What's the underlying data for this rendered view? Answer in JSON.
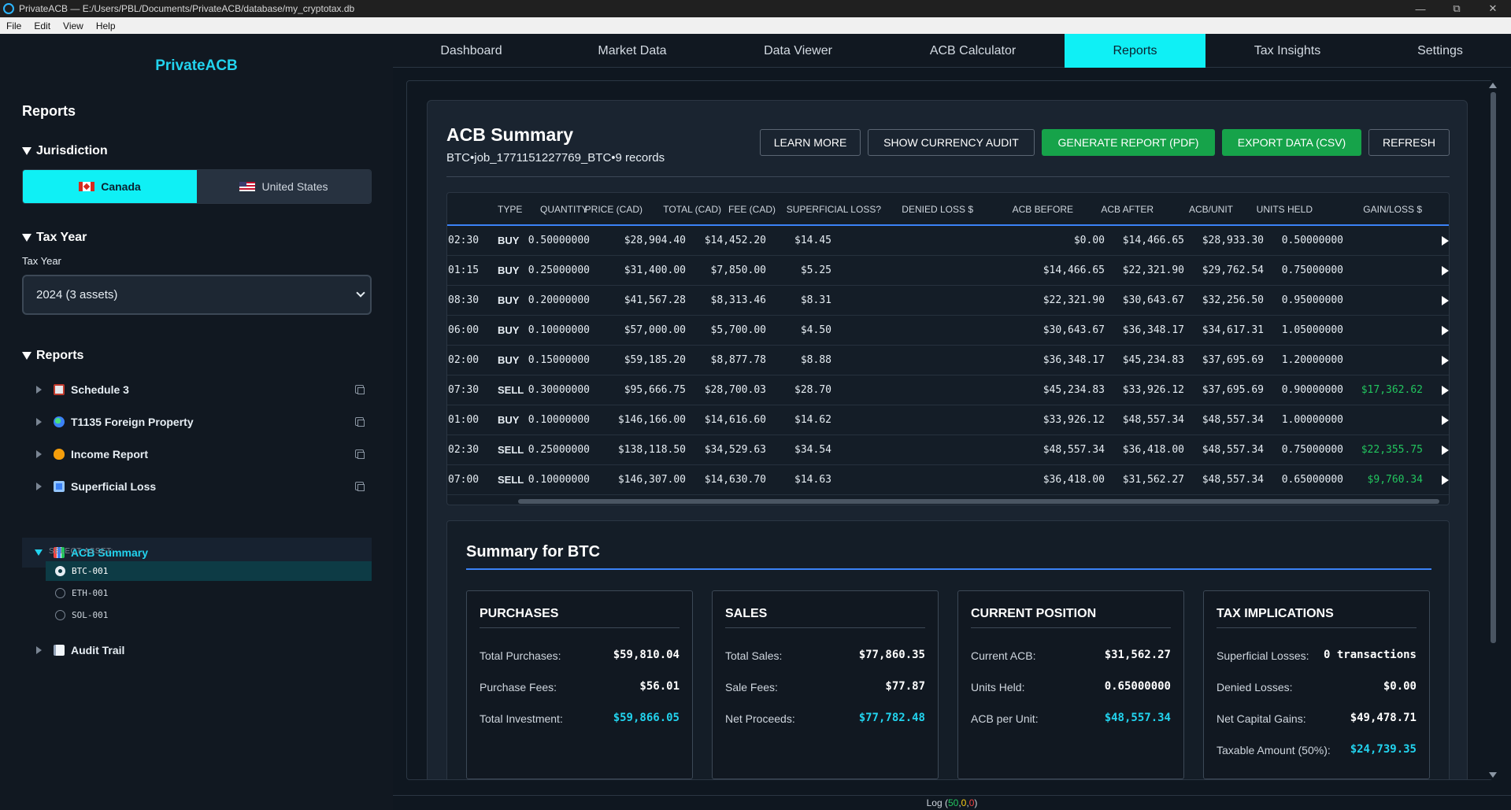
{
  "window": {
    "title": "PrivateACB — E:/Users/PBL/Documents/PrivateACB/database/my_cryptotax.db",
    "menu": [
      "File",
      "Edit",
      "View",
      "Help"
    ]
  },
  "sidebar": {
    "brand": "PrivateACB",
    "heading": "Reports",
    "jurisdiction": {
      "title": "Jurisdiction",
      "options": [
        "Canada",
        "United States"
      ],
      "selected": "Canada"
    },
    "tax_year": {
      "title": "Tax Year",
      "label": "Tax Year",
      "selected": "2024 (3 assets)"
    },
    "reports": {
      "title": "Reports",
      "items": [
        {
          "label": "Schedule 3",
          "icon": "calculator-icon"
        },
        {
          "label": "T1135 Foreign Property",
          "icon": "globe-icon"
        },
        {
          "label": "Income Report",
          "icon": "money-bag-icon"
        },
        {
          "label": "Superficial Loss",
          "icon": "cycle-icon"
        },
        {
          "label": "ACB Summary",
          "icon": "bar-chart-icon"
        },
        {
          "label": "Audit Trail",
          "icon": "document-icon"
        }
      ],
      "select_asset_label": "SELECT ASSET:",
      "assets": [
        "BTC-001",
        "ETH-001",
        "SOL-001"
      ],
      "selected_asset": "BTC-001"
    }
  },
  "tabs": [
    "Dashboard",
    "Market Data",
    "Data Viewer",
    "ACB Calculator",
    "Reports",
    "Tax Insights",
    "Settings"
  ],
  "active_tab": "Reports",
  "report": {
    "title": "ACB Summary",
    "subtitle": "BTC•job_1771151227769_BTC•9 records",
    "buttons": {
      "learn_more": "LEARN MORE",
      "currency_audit": "SHOW CURRENCY AUDIT",
      "generate_pdf": "GENERATE REPORT (PDF)",
      "export_csv": "EXPORT DATA (CSV)",
      "refresh": "REFRESH"
    },
    "columns": [
      "TYPE",
      "QUANTITY",
      "PRICE (CAD)",
      "TOTAL (CAD)",
      "FEE (CAD)",
      "SUPERFICIAL LOSS?",
      "DENIED LOSS $",
      "ACB BEFORE",
      "ACB AFTER",
      "ACB/UNIT",
      "UNITS HELD",
      "GAIN/LOSS $"
    ],
    "rows": [
      {
        "time": "02:30",
        "type": "BUY",
        "qty": "0.50000000",
        "price": "$28,904.40",
        "total": "$14,452.20",
        "fee": "$14.45",
        "sup": "",
        "denied": "",
        "before": "$0.00",
        "after": "$14,466.65",
        "unit": "$28,933.30",
        "held": "0.50000000",
        "gain": ""
      },
      {
        "time": "01:15",
        "type": "BUY",
        "qty": "0.25000000",
        "price": "$31,400.00",
        "total": "$7,850.00",
        "fee": "$5.25",
        "sup": "",
        "denied": "",
        "before": "$14,466.65",
        "after": "$22,321.90",
        "unit": "$29,762.54",
        "held": "0.75000000",
        "gain": ""
      },
      {
        "time": "08:30",
        "type": "BUY",
        "qty": "0.20000000",
        "price": "$41,567.28",
        "total": "$8,313.46",
        "fee": "$8.31",
        "sup": "",
        "denied": "",
        "before": "$22,321.90",
        "after": "$30,643.67",
        "unit": "$32,256.50",
        "held": "0.95000000",
        "gain": ""
      },
      {
        "time": "06:00",
        "type": "BUY",
        "qty": "0.10000000",
        "price": "$57,000.00",
        "total": "$5,700.00",
        "fee": "$4.50",
        "sup": "",
        "denied": "",
        "before": "$30,643.67",
        "after": "$36,348.17",
        "unit": "$34,617.31",
        "held": "1.05000000",
        "gain": ""
      },
      {
        "time": "02:00",
        "type": "BUY",
        "qty": "0.15000000",
        "price": "$59,185.20",
        "total": "$8,877.78",
        "fee": "$8.88",
        "sup": "",
        "denied": "",
        "before": "$36,348.17",
        "after": "$45,234.83",
        "unit": "$37,695.69",
        "held": "1.20000000",
        "gain": ""
      },
      {
        "time": "07:30",
        "type": "SELL",
        "qty": "0.30000000",
        "price": "$95,666.75",
        "total": "$28,700.03",
        "fee": "$28.70",
        "sup": "",
        "denied": "",
        "before": "$45,234.83",
        "after": "$33,926.12",
        "unit": "$37,695.69",
        "held": "0.90000000",
        "gain": "$17,362.62"
      },
      {
        "time": "01:00",
        "type": "BUY",
        "qty": "0.10000000",
        "price": "$146,166.00",
        "total": "$14,616.60",
        "fee": "$14.62",
        "sup": "",
        "denied": "",
        "before": "$33,926.12",
        "after": "$48,557.34",
        "unit": "$48,557.34",
        "held": "1.00000000",
        "gain": ""
      },
      {
        "time": "02:30",
        "type": "SELL",
        "qty": "0.25000000",
        "price": "$138,118.50",
        "total": "$34,529.63",
        "fee": "$34.54",
        "sup": "",
        "denied": "",
        "before": "$48,557.34",
        "after": "$36,418.00",
        "unit": "$48,557.34",
        "held": "0.75000000",
        "gain": "$22,355.75"
      },
      {
        "time": "07:00",
        "type": "SELL",
        "qty": "0.10000000",
        "price": "$146,307.00",
        "total": "$14,630.70",
        "fee": "$14.63",
        "sup": "",
        "denied": "",
        "before": "$36,418.00",
        "after": "$31,562.27",
        "unit": "$48,557.34",
        "held": "0.65000000",
        "gain": "$9,760.34"
      }
    ],
    "summary": {
      "title": "Summary for BTC",
      "purchases": {
        "title": "PURCHASES",
        "items": [
          {
            "k": "Total Purchases:",
            "v": "$59,810.04",
            "accent": false
          },
          {
            "k": "Purchase Fees:",
            "v": "$56.01",
            "accent": false
          },
          {
            "k": "Total Investment:",
            "v": "$59,866.05",
            "accent": true
          }
        ]
      },
      "sales": {
        "title": "SALES",
        "items": [
          {
            "k": "Total Sales:",
            "v": "$77,860.35",
            "accent": false
          },
          {
            "k": "Sale Fees:",
            "v": "$77.87",
            "accent": false
          },
          {
            "k": "Net Proceeds:",
            "v": "$77,782.48",
            "accent": true
          }
        ]
      },
      "position": {
        "title": "CURRENT POSITION",
        "items": [
          {
            "k": "Current ACB:",
            "v": "$31,562.27",
            "accent": false
          },
          {
            "k": "Units Held:",
            "v": "0.65000000",
            "accent": false
          },
          {
            "k": "ACB per Unit:",
            "v": "$48,557.34",
            "accent": true
          }
        ]
      },
      "tax": {
        "title": "TAX IMPLICATIONS",
        "items": [
          {
            "k": "Superficial Losses:",
            "v": "0 transactions",
            "accent": false
          },
          {
            "k": "Denied Losses:",
            "v": "$0.00",
            "accent": false
          },
          {
            "k": "Net Capital Gains:",
            "v": "$49,478.71",
            "accent": false
          },
          {
            "k": "Taxable Amount (50%):",
            "v": "$24,739.35",
            "accent": true
          }
        ]
      }
    }
  },
  "status": {
    "label": "Log",
    "open": "(",
    "n1": "50",
    "sep1": ",",
    "n2": "0",
    "sep2": ",",
    "n3": "0",
    "close": ")"
  },
  "colors": {
    "accent": "#0ff0f5",
    "green": "#16a34a",
    "gain": "#22c55e",
    "brand": "#22d3ee"
  }
}
